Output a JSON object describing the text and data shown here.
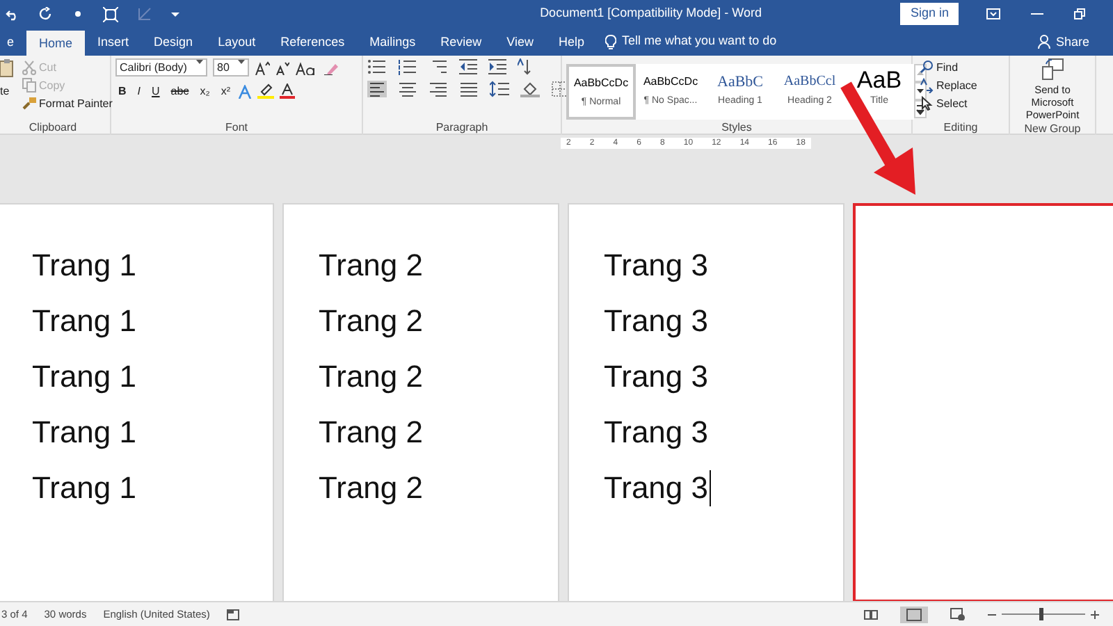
{
  "title_bar": {
    "title": "Document1 [Compatibility Mode]  -  Word",
    "sign_in": "Sign in"
  },
  "tabs": [
    {
      "label": "e",
      "selected": false
    },
    {
      "label": "Home",
      "selected": true
    },
    {
      "label": "Insert",
      "selected": false
    },
    {
      "label": "Design",
      "selected": false
    },
    {
      "label": "Layout",
      "selected": false
    },
    {
      "label": "References",
      "selected": false
    },
    {
      "label": "Mailings",
      "selected": false
    },
    {
      "label": "Review",
      "selected": false
    },
    {
      "label": "View",
      "selected": false
    },
    {
      "label": "Help",
      "selected": false
    }
  ],
  "tell_me": "Tell me what you want to do",
  "share": "Share",
  "clipboard": {
    "paste": "te",
    "items": [
      {
        "label": "Cut",
        "disabled": true
      },
      {
        "label": "Copy",
        "disabled": true
      },
      {
        "label": "Format Painter",
        "disabled": false
      }
    ],
    "label": "Clipboard"
  },
  "font": {
    "name": "Calibri (Body)",
    "size": "80",
    "format_buttons": [
      "B",
      "I",
      "U",
      "abc",
      "x₂",
      "x²"
    ],
    "label": "Font"
  },
  "paragraph": {
    "label": "Paragraph"
  },
  "styles": {
    "items": [
      {
        "preview": "AaBbCcDc",
        "name": "¶ Normal",
        "kind": "body",
        "selected": true
      },
      {
        "preview": "AaBbCcDc",
        "name": "¶ No Spac...",
        "kind": "body",
        "selected": false
      },
      {
        "preview": "AaBbC",
        "name": "Heading 1",
        "kind": "heading1",
        "selected": false
      },
      {
        "preview": "AaBbCcl",
        "name": "Heading 2",
        "kind": "heading2",
        "selected": false
      },
      {
        "preview": "AaB",
        "name": "Title",
        "kind": "title",
        "selected": false
      }
    ],
    "label": "Styles"
  },
  "editing": {
    "items": [
      "Find",
      "Replace",
      "Select"
    ],
    "label": "Editing"
  },
  "new_group": {
    "button": "Send to Microsoft PowerPoint",
    "label": "New Group"
  },
  "ruler": [
    "2",
    "2",
    "4",
    "6",
    "8",
    "10",
    "12",
    "14",
    "16",
    "18"
  ],
  "pages": [
    {
      "lines": [
        "Trang 1",
        "Trang 1",
        "Trang 1",
        "Trang 1",
        "Trang 1"
      ],
      "cursor": false,
      "highlighted": false
    },
    {
      "lines": [
        "Trang 2",
        "Trang 2",
        "Trang 2",
        "Trang 2",
        "Trang 2"
      ],
      "cursor": false,
      "highlighted": false
    },
    {
      "lines": [
        "Trang 3",
        "Trang 3",
        "Trang 3",
        "Trang 3",
        "Trang 3"
      ],
      "cursor": true,
      "highlighted": false
    },
    {
      "highlighted": true
    }
  ],
  "status_bar": {
    "items": [
      "3 of 4",
      "30 words",
      "English (United States)"
    ],
    "zoom": {
      "level": 0.45
    }
  }
}
